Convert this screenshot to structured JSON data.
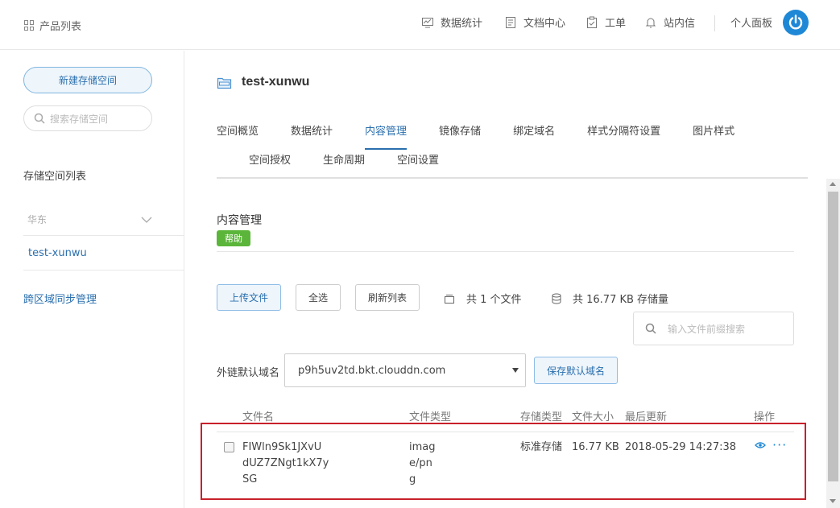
{
  "header": {
    "product_list": "产品列表",
    "nav": [
      {
        "label": "数据统计",
        "icon": "chart-icon"
      },
      {
        "label": "文档中心",
        "icon": "document-icon"
      },
      {
        "label": "工单",
        "icon": "clipboard-icon"
      },
      {
        "label": "站内信",
        "icon": "bell-icon"
      }
    ],
    "personal_panel": "个人面板"
  },
  "sidebar": {
    "new_bucket_button": "新建存储空间",
    "search_placeholder": "搜索存储空间",
    "list_title": "存储空间列表",
    "region": "华东",
    "bucket": "test-xunwu",
    "cross_region": "跨区域同步管理"
  },
  "main": {
    "title": "test-xunwu",
    "tabs_row1": [
      "空间概览",
      "数据统计",
      "内容管理",
      "镜像存储",
      "绑定域名",
      "样式分隔符设置",
      "图片样式"
    ],
    "tabs_row2": [
      "空间授权",
      "生命周期",
      "空间设置"
    ],
    "active_tab": "内容管理",
    "section_title": "内容管理",
    "help_badge": "帮助",
    "toolbar": {
      "upload": "上传文件",
      "select_all": "全选",
      "refresh": "刷新列表",
      "file_count": "共 1 个文件",
      "storage_size": "共 16.77 KB 存储量"
    },
    "file_search_placeholder": "输入文件前缀搜索",
    "domain": {
      "label": "外链默认域名",
      "selected": "p9h5uv2td.bkt.clouddn.com",
      "save_button": "保存默认域名"
    },
    "table": {
      "headers": [
        "文件名",
        "文件类型",
        "存储类型",
        "文件大小",
        "最后更新",
        "操作"
      ],
      "rows": [
        {
          "name_lines": [
            "FIWln9Sk1JXvU",
            "dUZ7ZNgt1kX7y",
            "SG"
          ],
          "type_lines": [
            "imag",
            "e/pn",
            "g"
          ],
          "storage": "标准存储",
          "size": "16.77 KB",
          "updated": "2018-05-29 14:27:38"
        }
      ]
    }
  },
  "colors": {
    "accent": "#2a6fae",
    "help_green": "#5bb53a",
    "highlight_red": "#c8202a",
    "avatar_blue": "#1e88d6"
  }
}
